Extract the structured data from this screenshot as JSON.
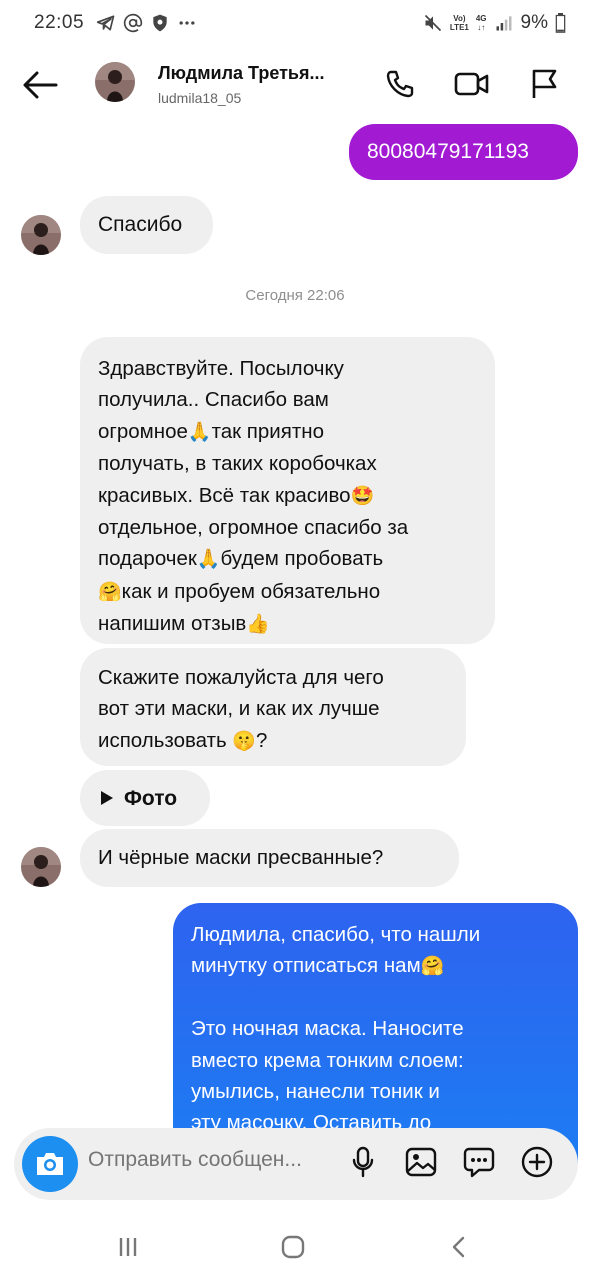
{
  "status_bar": {
    "time": "22:05",
    "network_top": "Vo)",
    "network_bottom": "LTE1",
    "net_type_top": "4G",
    "battery": "9%"
  },
  "header": {
    "name": "Людмила Третья...",
    "handle": "ludmila18_05",
    "icons": [
      "back-arrow-icon",
      "phone-icon",
      "video-icon",
      "flag-icon"
    ]
  },
  "messages": {
    "phone_number": "80080479171193",
    "thanks": "Спасибо",
    "timestamp": "Сегодня 22:06",
    "long_msg": {
      "l1": "Здравствуйте. Посылочку",
      "l2": "получила.. Спасибо вам",
      "l3a": "огромное",
      "l3b": "так приятно",
      "l4": "получать, в таких коробочках",
      "l5a": "красивых. Всё так красиво",
      "l6": "отдельное, огромное спасибо за",
      "l7a": "подарочек",
      "l7b": "будем пробовать",
      "l8b": "как и пробуем обязательно",
      "l9a": "напишим отзыв",
      "emoji_pray": "🙏",
      "emoji_star": "🤩",
      "emoji_hug": "🤗",
      "emoji_thumb": "👍"
    },
    "question": {
      "l1": "Скажите пожалуйста для чего",
      "l2": "вот эти маски, и как их лучше",
      "l3a": "использовать ",
      "l3b": "?",
      "emoji_shush": "🤫"
    },
    "photo_label": "Фото",
    "black_masks": "И чёрные маски пресванные?",
    "reply": {
      "l1": "Людмила, спасибо, что нашли",
      "l2a": "минутку отписаться нам",
      "emoji_hug": "🤗",
      "l4": "Это ночная маска. Наносите",
      "l5": "вместо крема тонким слоем:",
      "l6": "умылись, нанесли тоник и",
      "l7": "эту масочку. Оставить до"
    }
  },
  "composer": {
    "placeholder": "Отправить сообщен..."
  },
  "colors": {
    "purple_bubble": "#a21bd3",
    "blue_bubble": "#1d7cf2",
    "incoming_bubble": "#efefef",
    "camera_button": "#1c8ff0"
  }
}
